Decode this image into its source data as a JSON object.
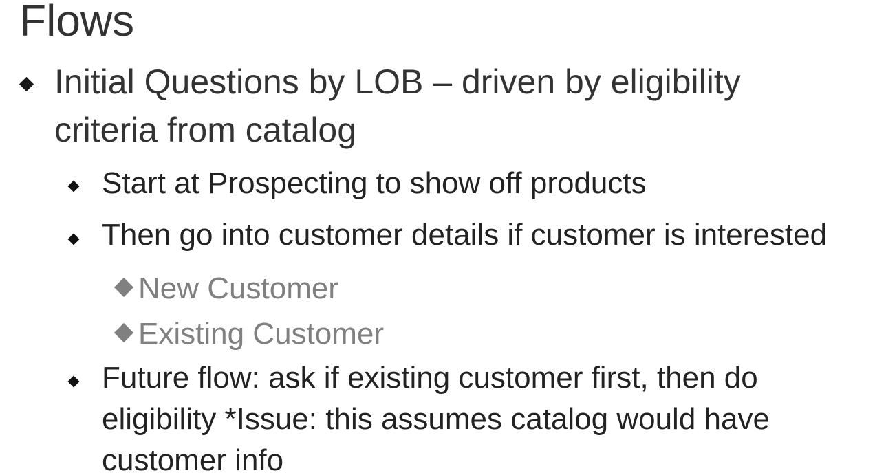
{
  "slide": {
    "title": "Flows",
    "bullets": [
      {
        "text": "Initial Questions by LOB – driven by eligibility criteria from catalog",
        "children": [
          {
            "text": "Start at Prospecting to show off products"
          },
          {
            "text": "Then go into customer details if customer is interested",
            "children": [
              {
                "text": "New Customer"
              },
              {
                "text": "Existing Customer"
              }
            ]
          },
          {
            "text": "Future flow: ask if existing customer first, then do eligibility *Issue: this assumes catalog would have customer info"
          }
        ]
      }
    ]
  }
}
